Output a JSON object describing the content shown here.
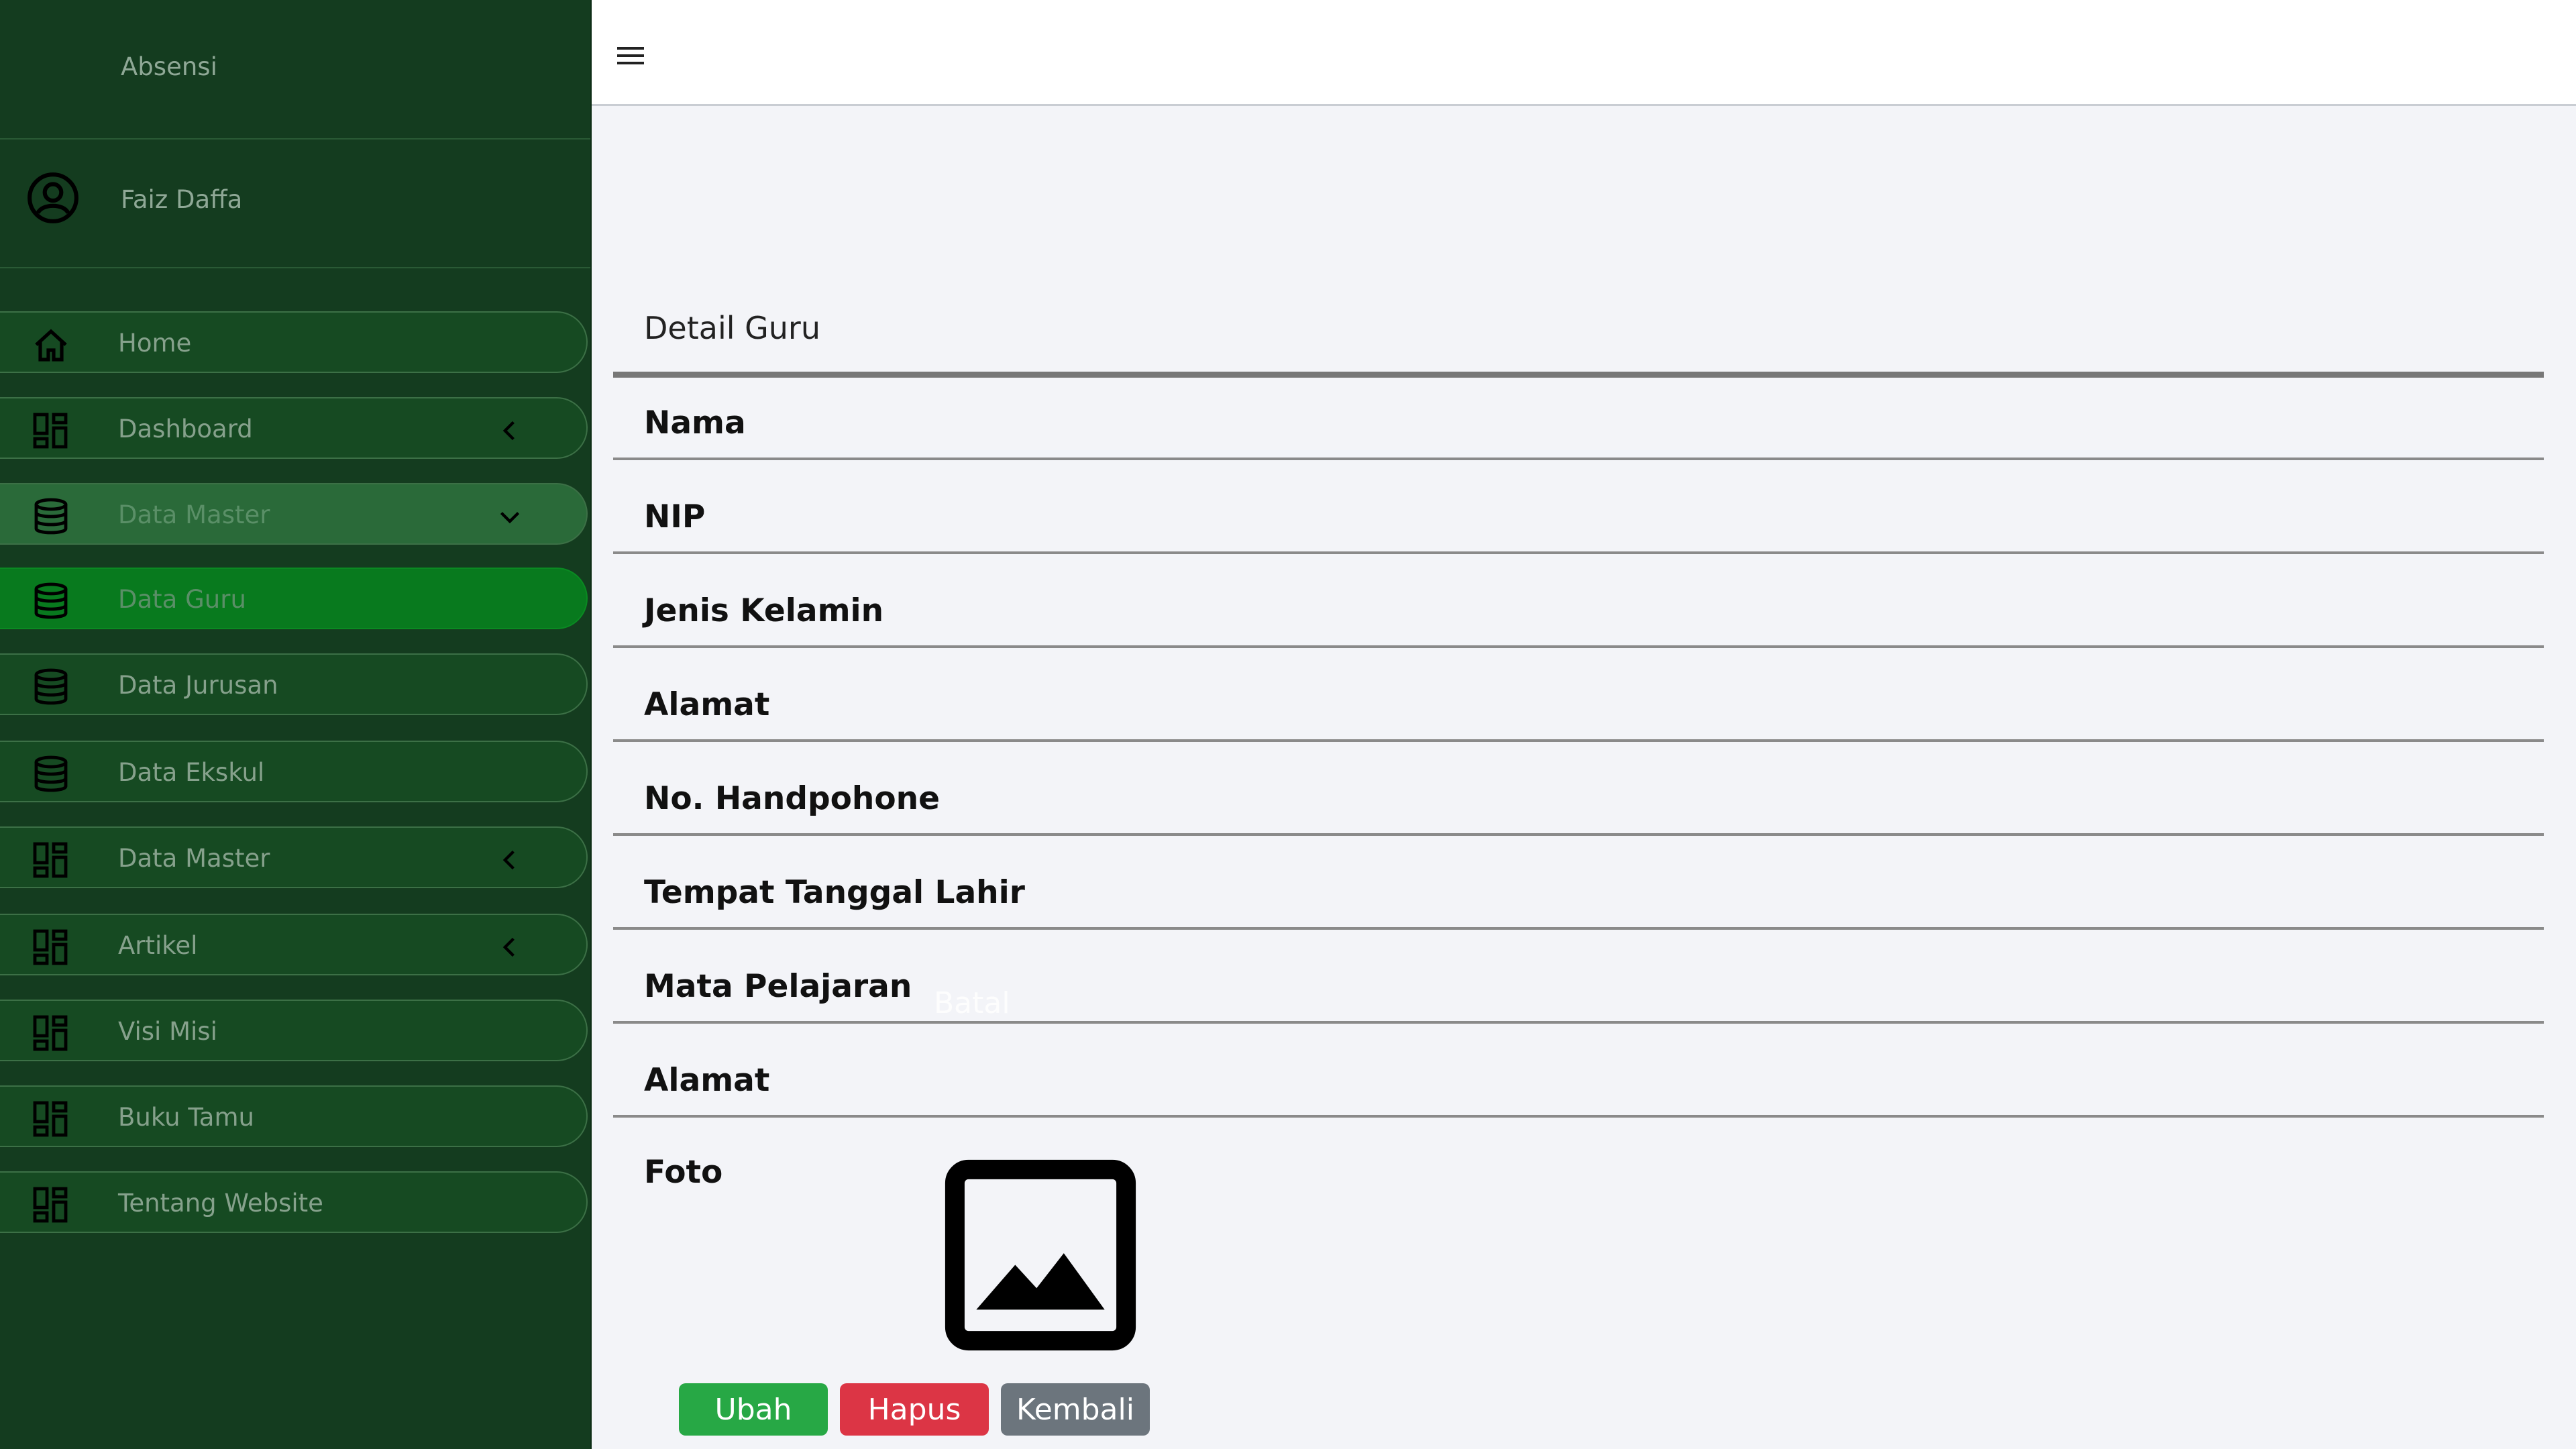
{
  "sidebar": {
    "brand": "Absensi",
    "user_name": "Faiz Daffa",
    "items": [
      {
        "label": "Home",
        "icon": "home-icon"
      },
      {
        "label": "Dashboard",
        "icon": "grid-icon",
        "caret": "chevron-left-icon"
      },
      {
        "label": "Data Master",
        "icon": "database-icon",
        "caret": "chevron-down-icon",
        "state": "open"
      },
      {
        "label": "Data Guru",
        "icon": "database-icon",
        "state": "active"
      },
      {
        "label": "Data Jurusan",
        "icon": "database-icon"
      },
      {
        "label": "Data Ekskul",
        "icon": "database-icon"
      },
      {
        "label": "Data Master",
        "icon": "grid-icon",
        "caret": "chevron-left-icon"
      },
      {
        "label": "Artikel",
        "icon": "grid-icon",
        "caret": "chevron-left-icon"
      },
      {
        "label": "Visi Misi",
        "icon": "grid-icon"
      },
      {
        "label": "Buku Tamu",
        "icon": "grid-icon"
      },
      {
        "label": "Tentang Website",
        "icon": "grid-icon"
      }
    ]
  },
  "topbar": {
    "menu_icon": "hamburger-icon"
  },
  "detail": {
    "title": "Detail Guru",
    "fields": [
      {
        "label": "Nama",
        "value": ""
      },
      {
        "label": "NIP",
        "value": ""
      },
      {
        "label": "Jenis Kelamin",
        "value": ""
      },
      {
        "label": "Alamat",
        "value": ""
      },
      {
        "label": "No. Handpohone",
        "value": ""
      },
      {
        "label": "Tempat Tanggal Lahir",
        "value": ""
      },
      {
        "label": "Mata Pelajaran",
        "value": ""
      },
      {
        "label": "Alamat",
        "value": ""
      }
    ],
    "photo_label": "Foto",
    "photo_icon": "image-placeholder-icon",
    "ghost_text": "Batal"
  },
  "actions": {
    "edit_label": "Ubah",
    "delete_label": "Hapus",
    "back_label": "Kembali"
  },
  "colors": {
    "sidebar_bg": "#143c1f",
    "active_item": "#087a1e",
    "edit": "#27a845",
    "delete": "#dc3545",
    "back": "#6c757d"
  }
}
